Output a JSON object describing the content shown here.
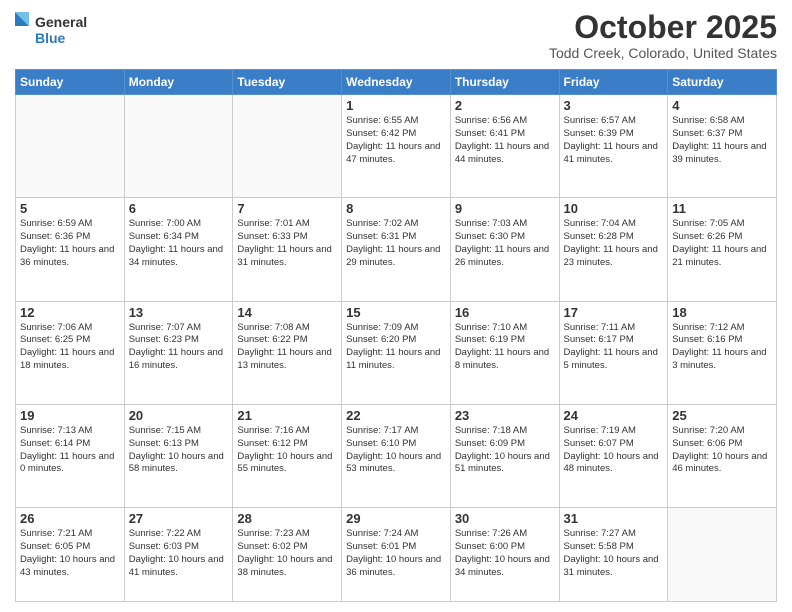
{
  "header": {
    "logo_general": "General",
    "logo_blue": "Blue",
    "month_title": "October 2025",
    "location": "Todd Creek, Colorado, United States"
  },
  "weekdays": [
    "Sunday",
    "Monday",
    "Tuesday",
    "Wednesday",
    "Thursday",
    "Friday",
    "Saturday"
  ],
  "weeks": [
    [
      {
        "day": "",
        "info": ""
      },
      {
        "day": "",
        "info": ""
      },
      {
        "day": "",
        "info": ""
      },
      {
        "day": "1",
        "info": "Sunrise: 6:55 AM\nSunset: 6:42 PM\nDaylight: 11 hours and 47 minutes."
      },
      {
        "day": "2",
        "info": "Sunrise: 6:56 AM\nSunset: 6:41 PM\nDaylight: 11 hours and 44 minutes."
      },
      {
        "day": "3",
        "info": "Sunrise: 6:57 AM\nSunset: 6:39 PM\nDaylight: 11 hours and 41 minutes."
      },
      {
        "day": "4",
        "info": "Sunrise: 6:58 AM\nSunset: 6:37 PM\nDaylight: 11 hours and 39 minutes."
      }
    ],
    [
      {
        "day": "5",
        "info": "Sunrise: 6:59 AM\nSunset: 6:36 PM\nDaylight: 11 hours and 36 minutes."
      },
      {
        "day": "6",
        "info": "Sunrise: 7:00 AM\nSunset: 6:34 PM\nDaylight: 11 hours and 34 minutes."
      },
      {
        "day": "7",
        "info": "Sunrise: 7:01 AM\nSunset: 6:33 PM\nDaylight: 11 hours and 31 minutes."
      },
      {
        "day": "8",
        "info": "Sunrise: 7:02 AM\nSunset: 6:31 PM\nDaylight: 11 hours and 29 minutes."
      },
      {
        "day": "9",
        "info": "Sunrise: 7:03 AM\nSunset: 6:30 PM\nDaylight: 11 hours and 26 minutes."
      },
      {
        "day": "10",
        "info": "Sunrise: 7:04 AM\nSunset: 6:28 PM\nDaylight: 11 hours and 23 minutes."
      },
      {
        "day": "11",
        "info": "Sunrise: 7:05 AM\nSunset: 6:26 PM\nDaylight: 11 hours and 21 minutes."
      }
    ],
    [
      {
        "day": "12",
        "info": "Sunrise: 7:06 AM\nSunset: 6:25 PM\nDaylight: 11 hours and 18 minutes."
      },
      {
        "day": "13",
        "info": "Sunrise: 7:07 AM\nSunset: 6:23 PM\nDaylight: 11 hours and 16 minutes."
      },
      {
        "day": "14",
        "info": "Sunrise: 7:08 AM\nSunset: 6:22 PM\nDaylight: 11 hours and 13 minutes."
      },
      {
        "day": "15",
        "info": "Sunrise: 7:09 AM\nSunset: 6:20 PM\nDaylight: 11 hours and 11 minutes."
      },
      {
        "day": "16",
        "info": "Sunrise: 7:10 AM\nSunset: 6:19 PM\nDaylight: 11 hours and 8 minutes."
      },
      {
        "day": "17",
        "info": "Sunrise: 7:11 AM\nSunset: 6:17 PM\nDaylight: 11 hours and 5 minutes."
      },
      {
        "day": "18",
        "info": "Sunrise: 7:12 AM\nSunset: 6:16 PM\nDaylight: 11 hours and 3 minutes."
      }
    ],
    [
      {
        "day": "19",
        "info": "Sunrise: 7:13 AM\nSunset: 6:14 PM\nDaylight: 11 hours and 0 minutes."
      },
      {
        "day": "20",
        "info": "Sunrise: 7:15 AM\nSunset: 6:13 PM\nDaylight: 10 hours and 58 minutes."
      },
      {
        "day": "21",
        "info": "Sunrise: 7:16 AM\nSunset: 6:12 PM\nDaylight: 10 hours and 55 minutes."
      },
      {
        "day": "22",
        "info": "Sunrise: 7:17 AM\nSunset: 6:10 PM\nDaylight: 10 hours and 53 minutes."
      },
      {
        "day": "23",
        "info": "Sunrise: 7:18 AM\nSunset: 6:09 PM\nDaylight: 10 hours and 51 minutes."
      },
      {
        "day": "24",
        "info": "Sunrise: 7:19 AM\nSunset: 6:07 PM\nDaylight: 10 hours and 48 minutes."
      },
      {
        "day": "25",
        "info": "Sunrise: 7:20 AM\nSunset: 6:06 PM\nDaylight: 10 hours and 46 minutes."
      }
    ],
    [
      {
        "day": "26",
        "info": "Sunrise: 7:21 AM\nSunset: 6:05 PM\nDaylight: 10 hours and 43 minutes."
      },
      {
        "day": "27",
        "info": "Sunrise: 7:22 AM\nSunset: 6:03 PM\nDaylight: 10 hours and 41 minutes."
      },
      {
        "day": "28",
        "info": "Sunrise: 7:23 AM\nSunset: 6:02 PM\nDaylight: 10 hours and 38 minutes."
      },
      {
        "day": "29",
        "info": "Sunrise: 7:24 AM\nSunset: 6:01 PM\nDaylight: 10 hours and 36 minutes."
      },
      {
        "day": "30",
        "info": "Sunrise: 7:26 AM\nSunset: 6:00 PM\nDaylight: 10 hours and 34 minutes."
      },
      {
        "day": "31",
        "info": "Sunrise: 7:27 AM\nSunset: 5:58 PM\nDaylight: 10 hours and 31 minutes."
      },
      {
        "day": "",
        "info": ""
      }
    ]
  ]
}
